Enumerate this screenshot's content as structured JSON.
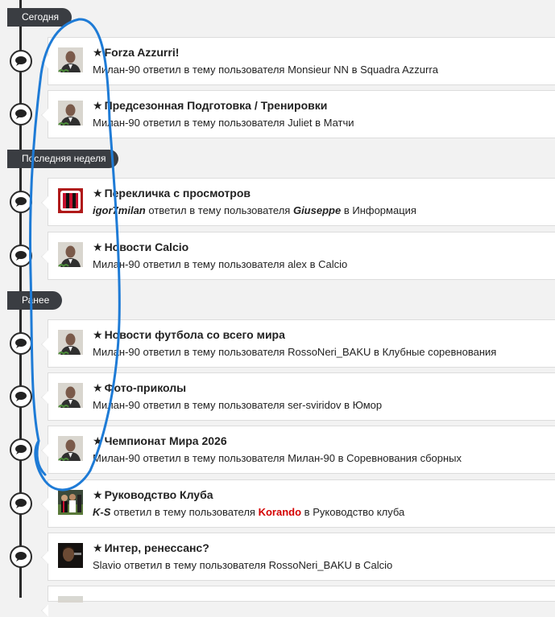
{
  "sections": {
    "today": "Сегодня",
    "last_week": "Последняя неделя",
    "earlier": "Ранее"
  },
  "colors": {
    "timeline": "#2b2b2b",
    "pill_bg": "#3a3d42",
    "card_bg": "#ffffff",
    "highlight_red": "#d40000",
    "scribble_blue": "#1e7bd6"
  },
  "icons": {
    "node": "speech-bubble-icon",
    "title": "star-icon"
  },
  "items": [
    {
      "title": "Forza Azzurri!",
      "user": "Милан-90",
      "verb": "ответил в тему пользователя",
      "author": "Monsieur NN",
      "prep": "в",
      "forum": "Squadra Azzurra",
      "avatar": "portrait"
    },
    {
      "title": "Предсезонная Подготовка / Тренировки",
      "user": "Милан-90",
      "verb": "ответил в тему пользователя",
      "author": "Juliet",
      "prep": "в",
      "forum": "Матчи",
      "avatar": "portrait"
    },
    {
      "title": "Перекличка с просмотров",
      "user": "igor7milan",
      "verb": "ответил в тему пользователя",
      "author": "Giuseppe",
      "prep": "в",
      "forum": "Информация",
      "avatar": "milan"
    },
    {
      "title": "Новости Calcio",
      "user": "Милан-90",
      "verb": "ответил в тему пользователя",
      "author": "alex",
      "prep": "в",
      "forum": "Calcio",
      "avatar": "portrait"
    },
    {
      "title": "Новости футбола со всего мира",
      "user": "Милан-90",
      "verb": "ответил в тему пользователя",
      "author": "RossoNeri_BAKU",
      "prep": "в",
      "forum": "Клубные соревнования",
      "avatar": "portrait"
    },
    {
      "title": "Фото-приколы",
      "user": "Милан-90",
      "verb": "ответил в тему пользователя",
      "author": "ser-sviridov",
      "prep": "в",
      "forum": "Юмор",
      "avatar": "portrait"
    },
    {
      "title": "Чемпионат Мира 2026",
      "user": "Милан-90",
      "verb": "ответил в тему пользователя",
      "author": "Милан-90",
      "prep": "в",
      "forum": "Соревнования сборных",
      "avatar": "portrait"
    },
    {
      "title": "Руководство Клуба",
      "user": "K-S",
      "verb": "ответил в тему пользователя",
      "author": "Korando",
      "prep": "в",
      "forum": "Руководство клуба",
      "avatar": "team"
    },
    {
      "title": "Интер, ренессанс?",
      "user": "Slavio",
      "verb": "ответил в тему пользователя",
      "author": "RossoNeri_BAKU",
      "prep": "в",
      "forum": "Calcio",
      "avatar": "dark"
    }
  ]
}
